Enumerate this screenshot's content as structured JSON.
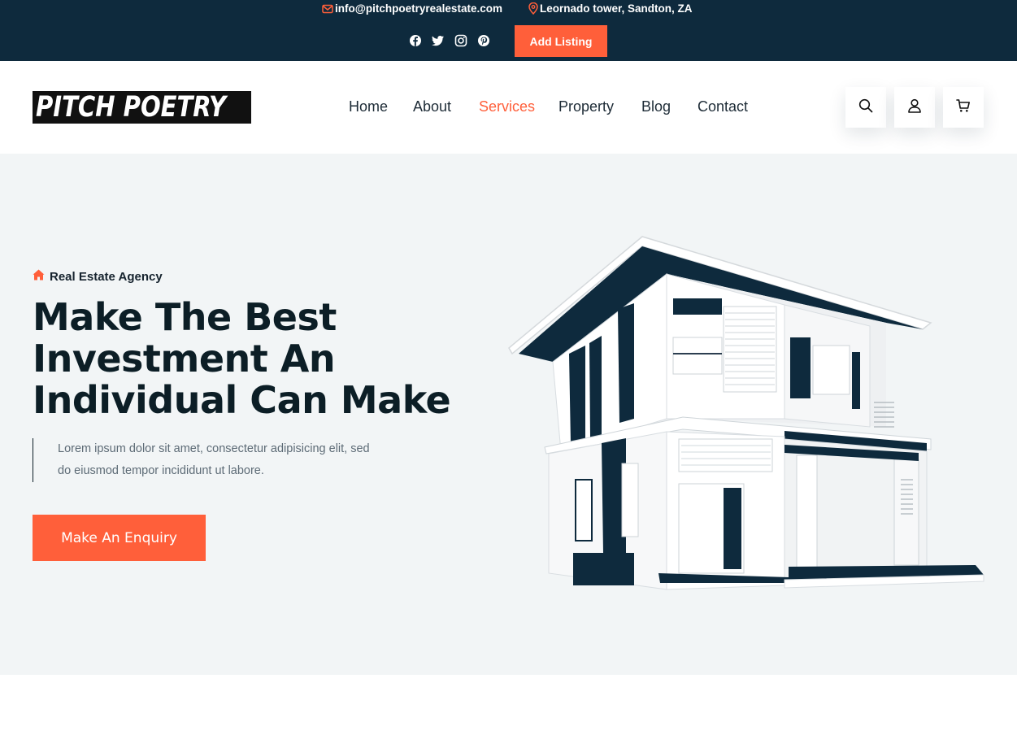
{
  "topbar": {
    "email": "info@pitchpoetryrealestate.com",
    "address": "Leornado tower, Sandton, ZA",
    "socials": [
      "facebook-icon",
      "twitter-icon",
      "instagram-icon",
      "pinterest-icon"
    ],
    "add_listing_label": "Add Listing"
  },
  "header": {
    "logo_text": "PITCH POETRY",
    "nav": [
      {
        "label": "Home",
        "active": false
      },
      {
        "label": "About",
        "active": false
      },
      {
        "label": "Services",
        "active": true
      },
      {
        "label": "Property",
        "active": false
      },
      {
        "label": "Blog",
        "active": false
      },
      {
        "label": "Contact",
        "active": false
      }
    ],
    "icons": [
      "search-icon",
      "user-icon",
      "cart-icon"
    ]
  },
  "hero": {
    "eyebrow": "Real Estate Agency",
    "headline_lines": [
      "Make The Best",
      "Investment An",
      "Individual Can Make"
    ],
    "description_lines": [
      "Lorem ipsum dolor sit amet, consectetur adipisicing elit, sed",
      "do eiusmod tempor incididunt ut labore."
    ],
    "cta_label": "Make An Enquiry"
  },
  "colors": {
    "accent": "#ff5f3a",
    "navy": "#0e2a3d",
    "hero_bg": "#f2f5f6"
  }
}
